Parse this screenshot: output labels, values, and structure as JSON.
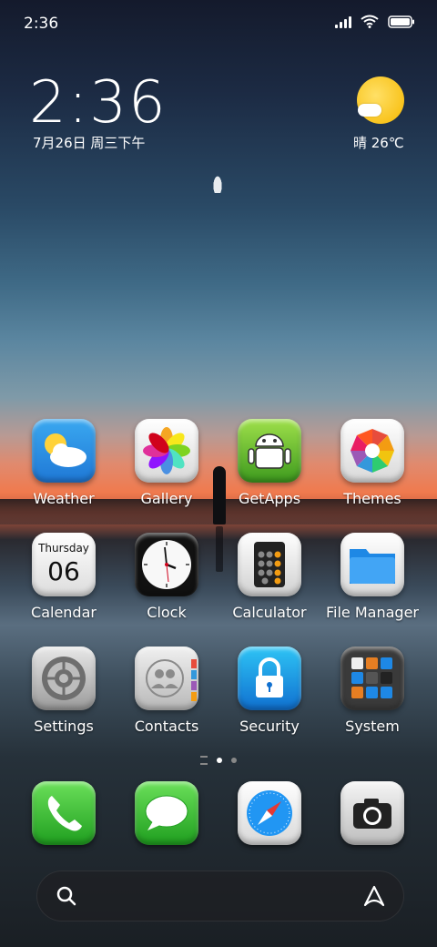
{
  "status_bar": {
    "time": "2:36"
  },
  "clock_widget": {
    "time": "2:36",
    "date": "7月26日 周三下午"
  },
  "weather_widget": {
    "condition_temp": "晴 26℃"
  },
  "apps": [
    {
      "label": "Weather"
    },
    {
      "label": "Gallery"
    },
    {
      "label": "GetApps"
    },
    {
      "label": "Themes"
    },
    {
      "label": "Calendar"
    },
    {
      "label": "Clock"
    },
    {
      "label": "Calculator"
    },
    {
      "label": "File Manager"
    },
    {
      "label": "Settings"
    },
    {
      "label": "Contacts"
    },
    {
      "label": "Security"
    },
    {
      "label": "System"
    }
  ],
  "calendar_icon": {
    "weekday": "Thursday",
    "day": "06"
  },
  "page_indicator": {
    "pages": 2,
    "active": 1
  },
  "dock": [
    "phone",
    "messages",
    "browser",
    "camera"
  ],
  "icons": [
    "signal-icon",
    "wifi-icon",
    "battery-icon",
    "search-icon",
    "assistant-icon"
  ]
}
